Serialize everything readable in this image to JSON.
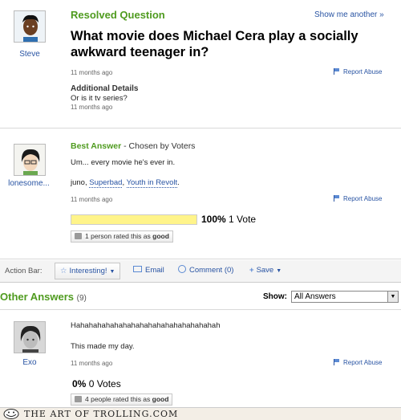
{
  "question": {
    "header": "Resolved Question",
    "show_more": "Show me another »",
    "title": "What movie does Michael Cera play a socially awkward teenager in?",
    "asker": "Steve",
    "time": "11 months ago",
    "report": "Report Abuse",
    "details_label": "Additional Details",
    "details_text": "Or is it tv series?",
    "details_time": "11 months ago"
  },
  "best_answer": {
    "header": "Best Answer",
    "chosen_by": "- Chosen by Voters",
    "answerer": "lonesome...",
    "line1": "Um... every movie he's ever in.",
    "line2_prefix": "juno,",
    "link1": "Superbad",
    "separator": ",",
    "link2": "Youth in Revolt",
    "line2_suffix": ".",
    "time": "11 months ago",
    "report": "Report Abuse",
    "vote_percent": "100%",
    "vote_count": "1 Vote",
    "vote_fraction": 1.0,
    "rated_prefix": "1 person rated this as",
    "rated_word": "good"
  },
  "action_bar": {
    "label": "Action Bar:",
    "interesting": "Interesting!",
    "email": "Email",
    "comment": "Comment (0)",
    "save": "Save"
  },
  "other_answers": {
    "title": "Other Answers",
    "count": "(9)",
    "show_label": "Show:",
    "show_value": "All Answers",
    "answer": {
      "answerer": "Exo",
      "line1": "Hahahahahahahahahahahahahahahahahah",
      "line2": "This made my day.",
      "time": "11 months ago",
      "report": "Report Abuse",
      "vote_percent": "0%",
      "vote_count": "0 Votes",
      "rated_prefix": "4 people rated this as",
      "rated_word": "good"
    }
  },
  "watermark": {
    "text": "THE ART OF TROLLING.COM"
  },
  "colors": {
    "green": "#4f9b1f",
    "link": "#2954a3",
    "vote_bar": "#fffcc6"
  }
}
